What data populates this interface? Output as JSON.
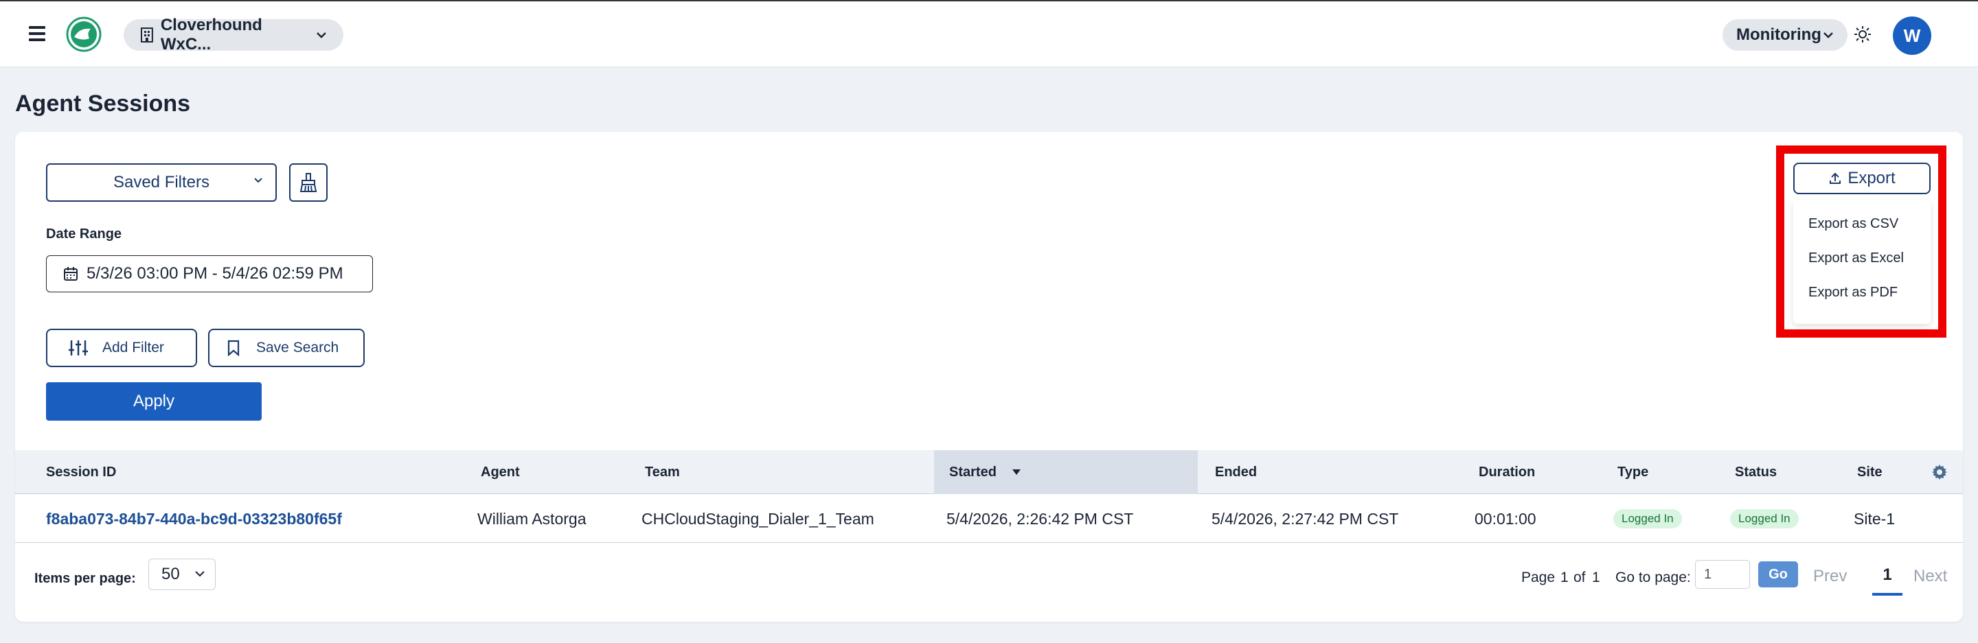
{
  "header": {
    "org_name": "Cloverhound WxC...",
    "monitoring_label": "Monitoring",
    "avatar_initial": "W",
    "icons": [
      "menu-icon",
      "logo-icon",
      "building-icon",
      "chevron-down-icon",
      "sun-icon"
    ]
  },
  "page": {
    "title": "Agent Sessions"
  },
  "filters": {
    "saved_filters_label": "Saved Filters",
    "date_range_label": "Date Range",
    "date_range_value": "5/3/26 03:00 PM - 5/4/26 02:59 PM",
    "add_filter_label": "Add Filter",
    "save_search_label": "Save Search",
    "apply_label": "Apply"
  },
  "export": {
    "button_label": "Export",
    "menu": [
      "Export as CSV",
      "Export as Excel",
      "Export as PDF"
    ],
    "highlight_color": "#ee0000"
  },
  "table": {
    "columns": [
      "Session ID",
      "Agent",
      "Team",
      "Started",
      "Ended",
      "Duration",
      "Type",
      "Status",
      "Site"
    ],
    "sort_column": "Started",
    "sort_direction": "descending",
    "rows": [
      {
        "session_id": "f8aba073-84b7-440a-bc9d-03323b80f65f",
        "agent": "William Astorga",
        "team": "CHCloudStaging_Dialer_1_Team",
        "started": "5/4/2026, 2:26:42 PM CST",
        "ended": "5/4/2026, 2:27:42 PM CST",
        "duration": "00:01:00",
        "type": "Logged In",
        "status": "Logged In",
        "site": "Site-1"
      }
    ]
  },
  "pagination": {
    "items_per_page_label": "Items per page:",
    "items_per_page": "50",
    "page_label": "Page",
    "current_page": "1",
    "of_label": "of",
    "total_pages": "1",
    "goto_label": "Go to page:",
    "goto_value": "1",
    "go_label": "Go",
    "prev_label": "Prev",
    "next_label": "Next"
  },
  "colors": {
    "primary": "#1a5fc0",
    "navy": "#1c3a6b",
    "badge_bg": "#d9f5e2",
    "badge_text": "#17743a"
  }
}
